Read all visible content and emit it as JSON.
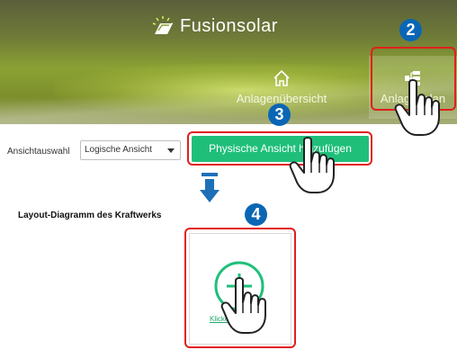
{
  "header": {
    "brand": "Fusionsolar",
    "nav": [
      {
        "label": "Anlagenübersicht",
        "icon": "home-icon"
      },
      {
        "label": "Anlagenplan",
        "icon": "plant-layout-icon"
      }
    ]
  },
  "toolbar": {
    "view_label": "Ansichtauswahl",
    "view_value": "Logische Ansicht",
    "add_button": "Physische Ansicht hinzufügen"
  },
  "section": {
    "title": "Layout-Diagramm des Kraftwerks",
    "card_link": "Klicken Sie hier"
  },
  "callouts": [
    "2",
    "3",
    "4"
  ],
  "colors": {
    "accent_green": "#1fbf7a",
    "callout_red": "#e0201c",
    "badge_blue": "#0a66b4"
  }
}
